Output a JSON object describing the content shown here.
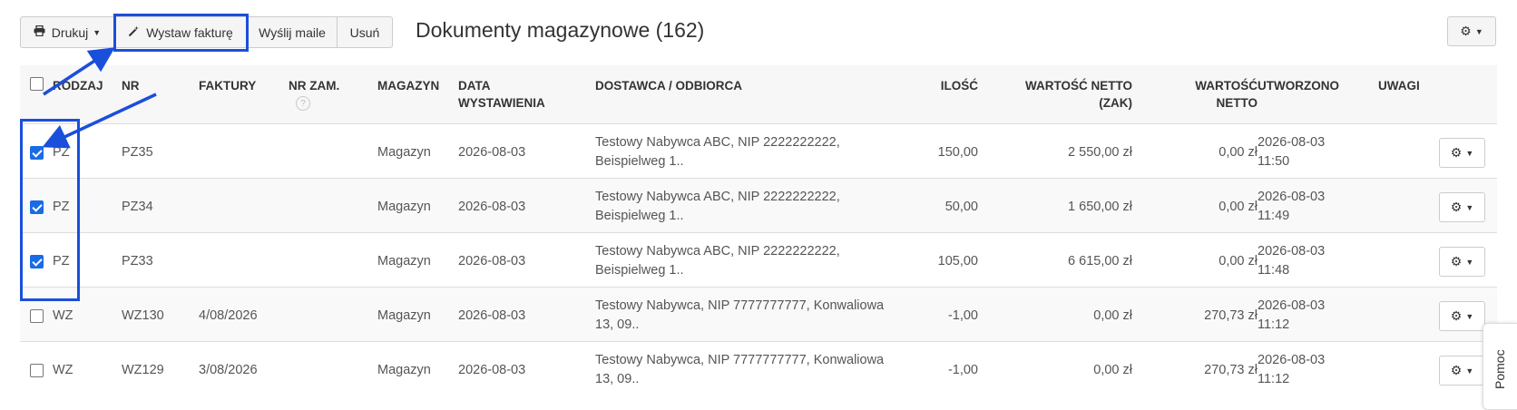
{
  "toolbar": {
    "print_label": "Drukuj",
    "invoice_label": "Wystaw fakturę",
    "mail_label": "Wyślij maile",
    "delete_label": "Usuń"
  },
  "page_title": "Dokumenty magazynowe (162)",
  "columns": {
    "type": "RODZAJ",
    "nr": "NR",
    "invoices": "FAKTURY",
    "order_nr": "NR ZAM.",
    "warehouse": "MAGAZYN",
    "date_line1": "DATA",
    "date_line2": "WYSTAWIENIA",
    "party": "DOSTAWCA / ODBIORCA",
    "qty": "ILOŚĆ",
    "net_zak_line1": "WARTOŚĆ NETTO",
    "net_zak_line2": "(ZAK)",
    "net_line1": "WARTOŚĆ",
    "net_line2": "NETTO",
    "created": "UTWORZONO",
    "notes": "UWAGI",
    "help_icon": "?"
  },
  "rows": [
    {
      "checked": true,
      "type": "PZ",
      "nr": "PZ35",
      "invoices": "",
      "warehouse": "Magazyn",
      "date": "2026-08-03",
      "party_line1": "Testowy Nabywca ABC, NIP 2222222222,",
      "party_line2": "Beispielweg 1..",
      "qty": "150,00",
      "net_zak": "2 550,00 zł",
      "net": "0,00 zł",
      "created_date": "2026-08-03",
      "created_time": "11:50"
    },
    {
      "checked": true,
      "type": "PZ",
      "nr": "PZ34",
      "invoices": "",
      "warehouse": "Magazyn",
      "date": "2026-08-03",
      "party_line1": "Testowy Nabywca ABC, NIP 2222222222,",
      "party_line2": "Beispielweg 1..",
      "qty": "50,00",
      "net_zak": "1 650,00 zł",
      "net": "0,00 zł",
      "created_date": "2026-08-03",
      "created_time": "11:49"
    },
    {
      "checked": true,
      "type": "PZ",
      "nr": "PZ33",
      "invoices": "",
      "warehouse": "Magazyn",
      "date": "2026-08-03",
      "party_line1": "Testowy Nabywca ABC, NIP 2222222222,",
      "party_line2": "Beispielweg 1..",
      "qty": "105,00",
      "net_zak": "6 615,00 zł",
      "net": "0,00 zł",
      "created_date": "2026-08-03",
      "created_time": "11:48"
    },
    {
      "checked": false,
      "type": "WZ",
      "nr": "WZ130",
      "invoices": "4/08/2026",
      "warehouse": "Magazyn",
      "date": "2026-08-03",
      "party_line1": "Testowy Nabywca, NIP 7777777777, Konwaliowa",
      "party_line2": "13, 09..",
      "qty": "-1,00",
      "net_zak": "0,00 zł",
      "net": "270,73 zł",
      "created_date": "2026-08-03",
      "created_time": "11:12"
    },
    {
      "checked": false,
      "type": "WZ",
      "nr": "WZ129",
      "invoices": "3/08/2026",
      "warehouse": "Magazyn",
      "date": "2026-08-03",
      "party_line1": "Testowy Nabywca, NIP 7777777777, Konwaliowa",
      "party_line2": "13, 09..",
      "qty": "-1,00",
      "net_zak": "0,00 zł",
      "net": "270,73 zł",
      "created_date": "2026-08-03",
      "created_time": "11:12"
    }
  ],
  "help_tab_label": "Pomoc",
  "colors": {
    "annotation": "#1a4fdb",
    "checkbox_checked": "#1a6be6"
  },
  "icons": {
    "print": "printer-icon",
    "invoice": "magic-wand-icon",
    "settings": "gear-icon",
    "caret": "caret-down-icon"
  }
}
